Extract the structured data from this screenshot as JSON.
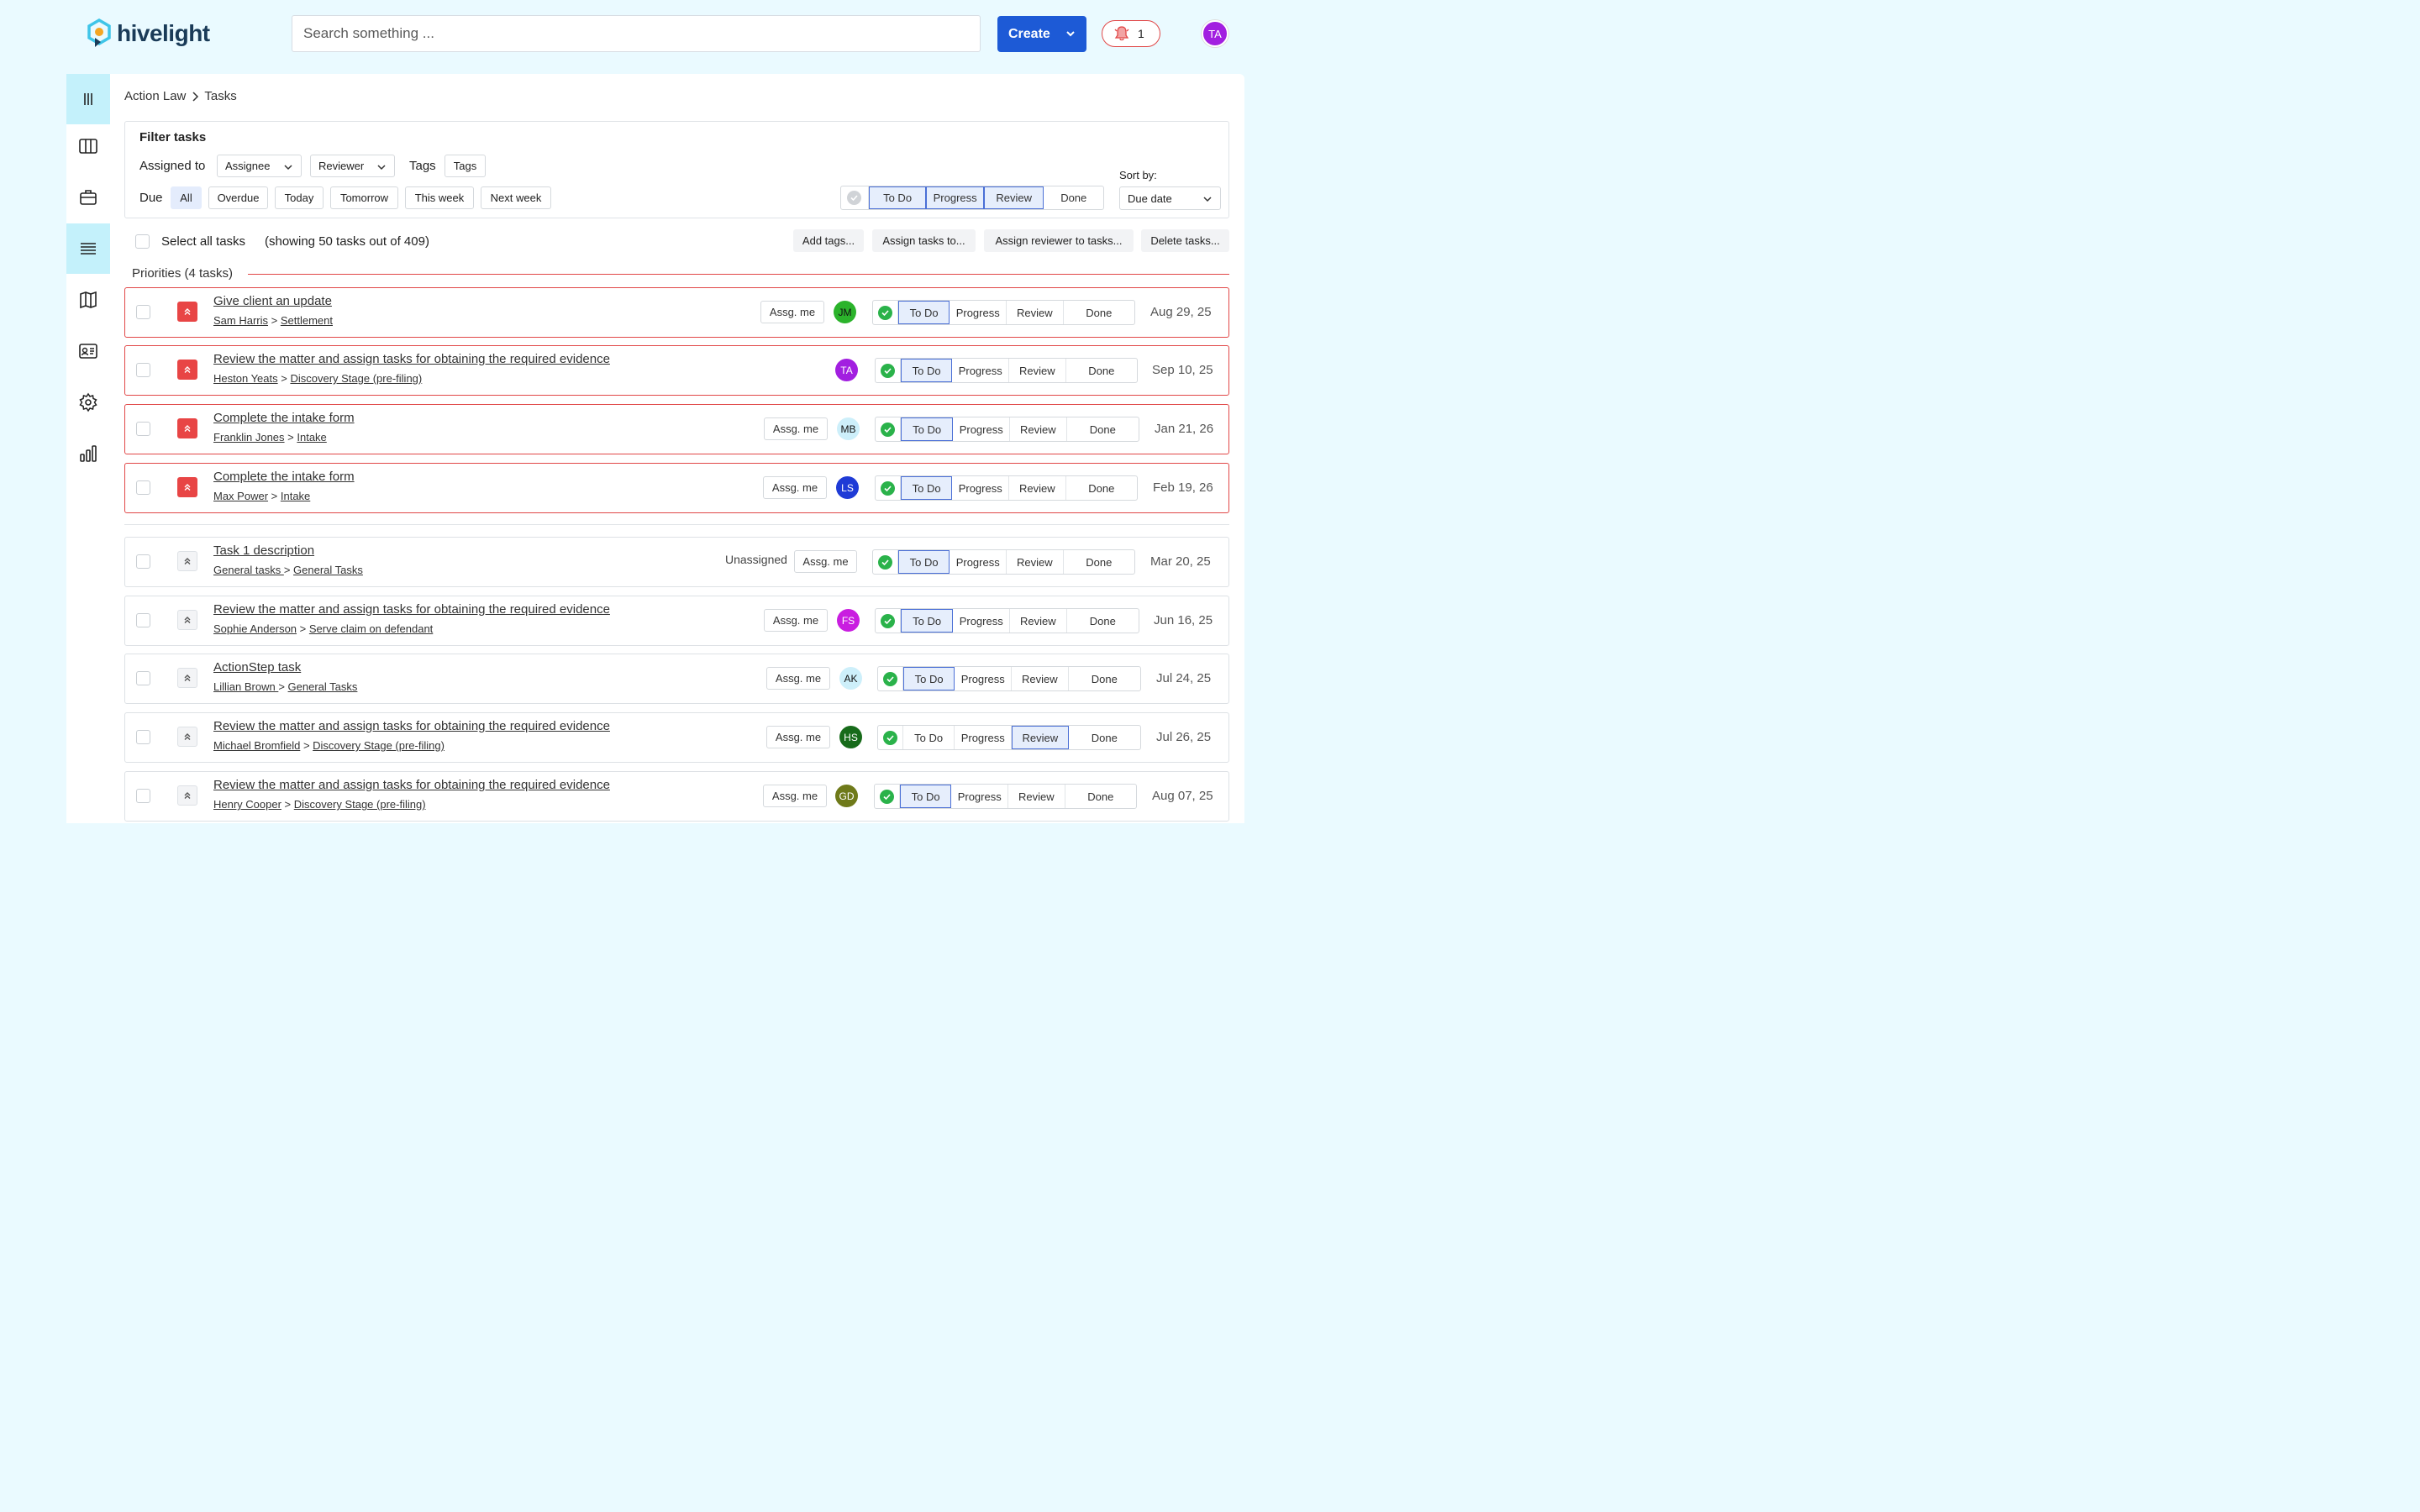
{
  "app": {
    "brand": "hivelight",
    "search_placeholder": "Search something ...",
    "create_label": "Create",
    "notifications_count": "1",
    "user_initials": "TA"
  },
  "breadcrumb": {
    "parent": "Action Law",
    "current": "Tasks"
  },
  "filter": {
    "title": "Filter tasks",
    "assigned_to_label": "Assigned to",
    "assignee": "Assignee",
    "reviewer": "Reviewer",
    "tags_label": "Tags",
    "tags_btn": "Tags",
    "due_label": "Due",
    "due_options": [
      "All",
      "Overdue",
      "Today",
      "Tomorrow",
      "This week",
      "Next week"
    ],
    "status_options": [
      "To Do",
      "Progress",
      "Review",
      "Done"
    ],
    "sort_label": "Sort by:",
    "sort_value": "Due date"
  },
  "bulk": {
    "select_all": "Select all tasks",
    "showing": "(showing 50 tasks out of 409)",
    "actions": [
      "Add tags...",
      "Assign tasks to...",
      "Assign reviewer to tasks...",
      "Delete tasks..."
    ]
  },
  "priorities_label": "Priorities (4 tasks)",
  "status_labels": [
    "To Do",
    "Progress",
    "Review",
    "Done"
  ],
  "assign_me": "Assg. me",
  "unassigned": "Unassigned",
  "tasks": [
    {
      "title": "Give client an update",
      "client": "Sam Harris",
      "stage": "Settlement",
      "assignee": "JM",
      "avatar_color": "#2bb32b",
      "avatar_text_color": "#111",
      "status": "To Do",
      "date": "Aug 29, 25",
      "priority": true
    },
    {
      "title": "Review the matter and assign tasks for obtaining the required evidence",
      "client": "Heston Yeats",
      "stage": "Discovery Stage (pre-filing)",
      "assignee": "TA",
      "avatar_color": "#a21fe0",
      "avatar_text_color": "#fff",
      "status": "To Do",
      "date": "Sep 10, 25",
      "priority": true
    },
    {
      "title": "Complete the intake form",
      "client": "Franklin Jones",
      "stage": "Intake",
      "assignee": "MB",
      "avatar_color": "#cdeffa",
      "avatar_text_color": "#111",
      "status": "To Do",
      "date": "Jan 21, 26",
      "priority": true
    },
    {
      "title": "Complete the intake form",
      "client": "Max Power",
      "stage": "Intake",
      "assignee": "LS",
      "avatar_color": "#1f3bd6",
      "avatar_text_color": "#fff",
      "status": "To Do",
      "date": "Feb 19, 26",
      "priority": true
    },
    {
      "title": "Task 1 description",
      "client": "General tasks ",
      "stage": "General Tasks",
      "assignee": "",
      "status": "To Do",
      "date": "Mar 20, 25",
      "priority": false
    },
    {
      "title": "Review the matter and assign tasks for obtaining the required evidence",
      "client": "Sophie Anderson",
      "stage": "Serve claim on defendant",
      "assignee": "FS",
      "avatar_color": "#c91ee0",
      "avatar_text_color": "#fff",
      "status": "To Do",
      "date": "Jun 16, 25",
      "priority": false
    },
    {
      "title": "ActionStep task",
      "client": "Lillian Brown ",
      "stage": "General Tasks",
      "assignee": "AK",
      "avatar_color": "#cdeffa",
      "avatar_text_color": "#111",
      "status": "To Do",
      "date": "Jul 24, 25",
      "priority": false
    },
    {
      "title": "Review the matter and assign tasks for obtaining the required evidence",
      "client": "Michael Bromfield",
      "stage": "Discovery Stage (pre-filing)",
      "assignee": "HS",
      "avatar_color": "#176b1a",
      "avatar_text_color": "#fff",
      "status": "Review",
      "date": "Jul 26, 25",
      "priority": false
    },
    {
      "title": "Review the matter and assign tasks for obtaining the required evidence",
      "client": "Henry Cooper",
      "stage": "Discovery Stage (pre-filing)",
      "assignee": "GD",
      "avatar_color": "#6f7a1a",
      "avatar_text_color": "#fff",
      "status": "To Do",
      "date": "Aug 07, 25",
      "priority": false
    }
  ],
  "colors": {
    "brand_blue": "#1d5ad6",
    "priority_red": "#e84545",
    "bg": "#eafaff",
    "active_nav": "#c4f1fb"
  }
}
